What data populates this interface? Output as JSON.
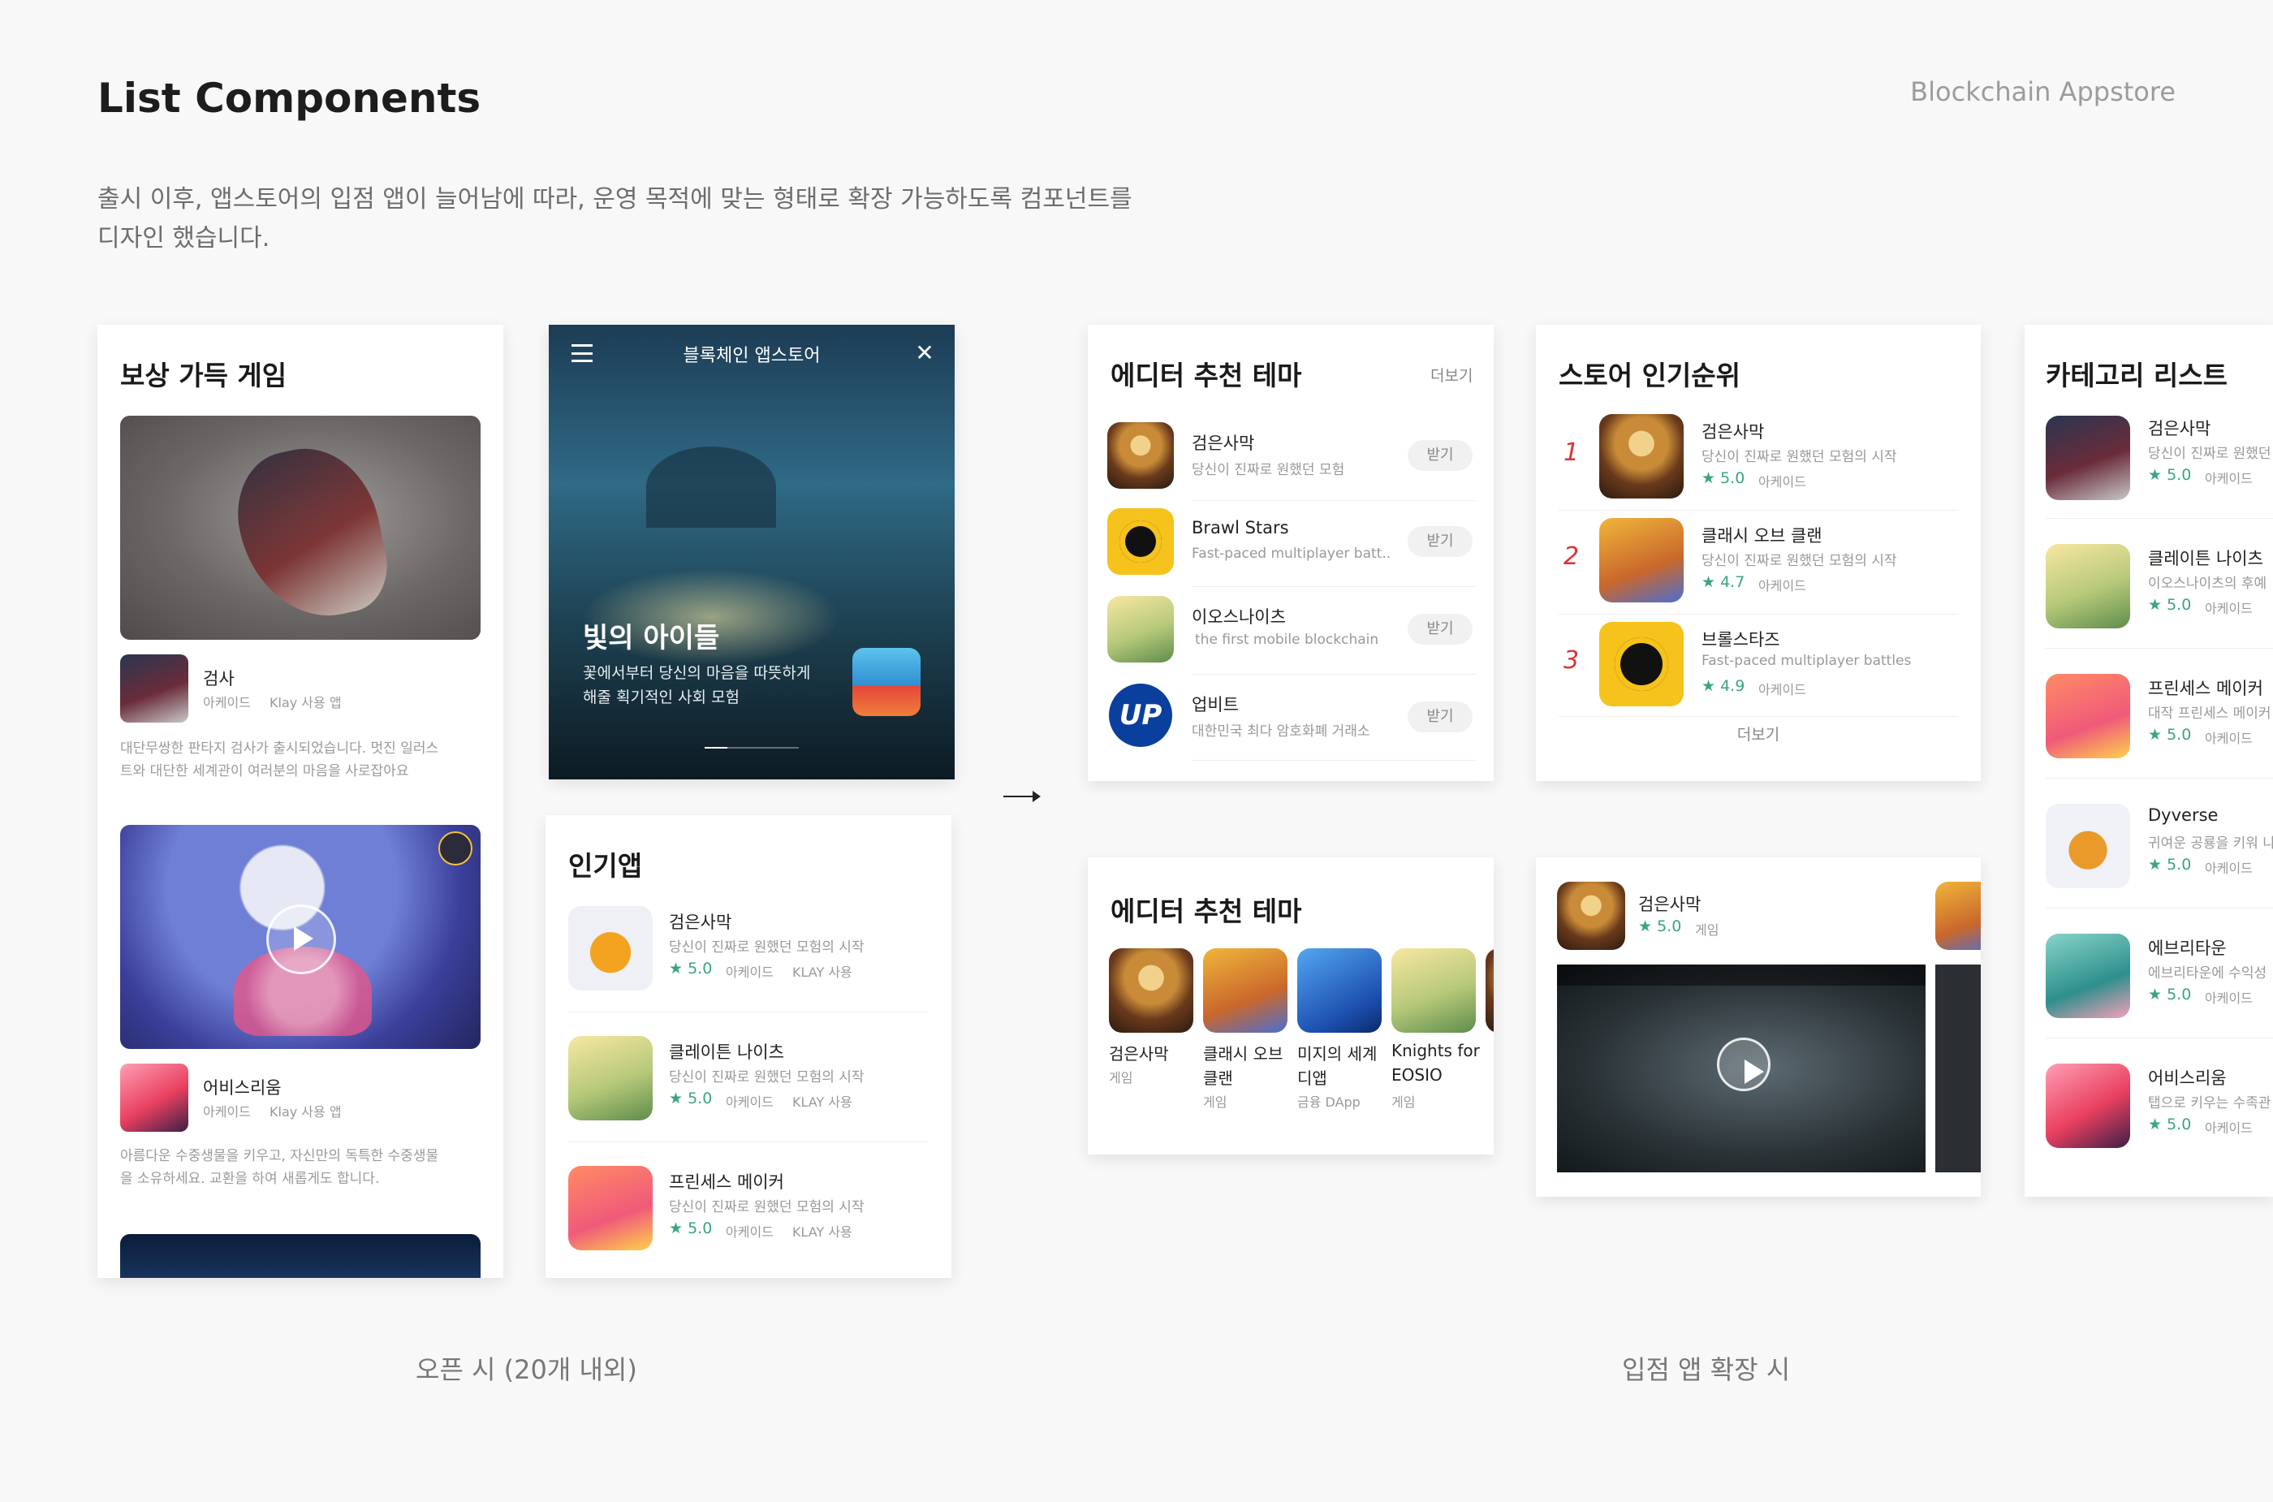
{
  "header": {
    "title": "List Components",
    "brand": "Blockchain Appstore",
    "description_line1": "출시 이후, 앱스토어의 입점 앱이 늘어남에 따라, 운영 목적에 맞는 형태로 확장 가능하도록 컴포넌트를",
    "description_line2": "디자인 했습니다."
  },
  "captions": {
    "open": "오픈 시 (20개 내외)",
    "expand": "입점 앱 확장 시"
  },
  "reward_card": {
    "title": "보상 가득 게임",
    "items": [
      {
        "name": "검사",
        "genre": "아케이드",
        "tag": "Klay 사용 앱",
        "desc1": "대단무쌍한 판타지 검사가 출시되었습니다. 멋진 일러스",
        "desc2": "트와 대단한 세계관이 여러분의 마음을 사로잡아요"
      },
      {
        "name": "어비스리움",
        "genre": "아케이드",
        "tag": "Klay 사용 앱",
        "desc1": "아름다운 수중생물을 키우고, 자신만의 독특한 수중생물",
        "desc2": "을 소유하세요. 교환을 하여 새롭게도 합니다."
      }
    ]
  },
  "banner_card": {
    "title": "블록체인 앱스토어",
    "headline": "빛의 아이들",
    "sub1": "꽃에서부터 당신의 마음을 따뜻하게",
    "sub2": "해줄 획기적인 사회 모험"
  },
  "popular_card": {
    "title": "인기앱",
    "items": [
      {
        "name": "검은사막",
        "desc": "당신이 진짜로 원했던 모험의 시작",
        "rating": "★ 5.0",
        "genre": "아케이드",
        "tag": "KLAY 사용"
      },
      {
        "name": "클레이튼 나이츠",
        "desc": "당신이 진짜로 원했던 모험의 시작",
        "rating": "★ 5.0",
        "genre": "아케이드",
        "tag": "KLAY 사용"
      },
      {
        "name": "프린세스 메이커",
        "desc": "당신이 진짜로 원했던 모험의 시작",
        "rating": "★ 5.0",
        "genre": "아케이드",
        "tag": "KLAY 사용"
      }
    ]
  },
  "editor_card": {
    "title": "에디터 추천 테마",
    "more": "더보기",
    "get_label": "받기",
    "items": [
      {
        "name": "검은사막",
        "desc": "당신이 진짜로 원했던 모험"
      },
      {
        "name": "Brawl Stars",
        "desc": "Fast-paced multiplayer batt.."
      },
      {
        "name": "이오스나이츠",
        "desc": "the first mobile blockchain"
      },
      {
        "name": "업비트",
        "desc": "대한민국 최다 암호화폐 거래소"
      }
    ]
  },
  "ranking_card": {
    "title": "스토어 인기순위",
    "more": "더보기",
    "items": [
      {
        "rank": "1",
        "name": "검은사막",
        "desc": "당신이 진짜로 원했던 모험의 시작",
        "rating": "★ 5.0",
        "genre": "아케이드"
      },
      {
        "rank": "2",
        "name": "클래시 오브 클랜",
        "desc": "당신이 진짜로 원했던 모험의 시작",
        "rating": "★ 4.7",
        "genre": "아케이드"
      },
      {
        "rank": "3",
        "name": "브롤스타즈",
        "desc": "Fast-paced multiplayer battles",
        "rating": "★ 4.9",
        "genre": "아케이드"
      }
    ]
  },
  "category_card": {
    "title": "카테고리 리스트",
    "items": [
      {
        "name": "검은사막",
        "desc": "당신이 진짜로 원했던",
        "rating": "★ 5.0",
        "genre": "아케이드"
      },
      {
        "name": "클레이튼 나이츠",
        "desc": "이오스나이츠의 후예",
        "rating": "★ 5.0",
        "genre": "아케이드"
      },
      {
        "name": "프린세스 메이커",
        "desc": "대작 프린세스 메이커",
        "rating": "★ 5.0",
        "genre": "아케이드"
      },
      {
        "name": "Dyverse",
        "desc": "귀여운 공룡을 키워 나",
        "rating": "★ 5.0",
        "genre": "아케이드"
      },
      {
        "name": "에브리타운",
        "desc": "에브리타운에 수익성",
        "rating": "★ 5.0",
        "genre": "아케이드"
      },
      {
        "name": "어비스리움",
        "desc": "탭으로 키우는 수족관",
        "rating": "★ 5.0",
        "genre": "아케이드"
      }
    ]
  },
  "theme_card": {
    "title": "에디터 추천 테마",
    "items": [
      {
        "name": "검은사막",
        "sub": "게임"
      },
      {
        "name": "클래시 오브",
        "name2": "클랜",
        "sub": "게임"
      },
      {
        "name": "미지의 세계",
        "name2": "디앱",
        "sub": "금융 DApp"
      },
      {
        "name": "Knights for",
        "name2": "EOSIO",
        "sub": "게임"
      }
    ]
  },
  "video_card": {
    "name": "검은사막",
    "rating": "★ 5.0",
    "genre": "게임"
  }
}
